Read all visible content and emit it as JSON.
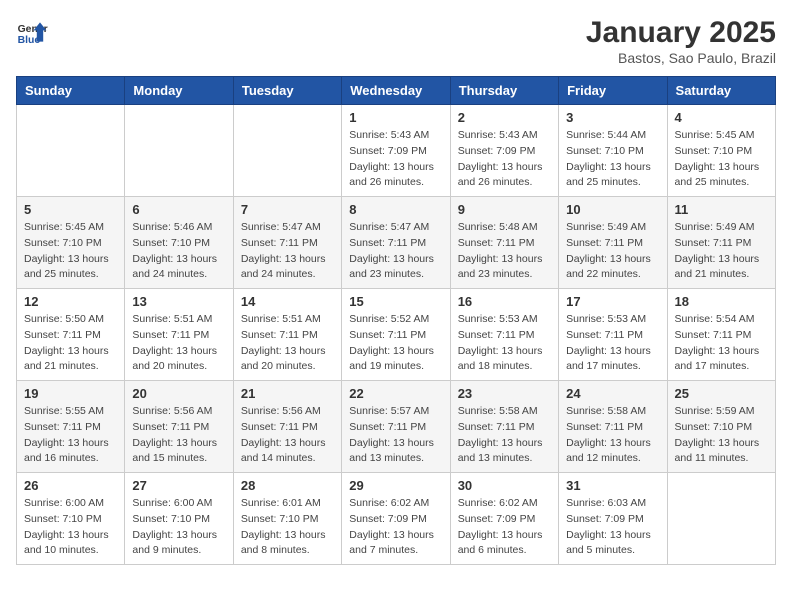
{
  "header": {
    "logo_general": "General",
    "logo_blue": "Blue",
    "month_title": "January 2025",
    "location": "Bastos, Sao Paulo, Brazil"
  },
  "weekdays": [
    "Sunday",
    "Monday",
    "Tuesday",
    "Wednesday",
    "Thursday",
    "Friday",
    "Saturday"
  ],
  "weeks": [
    [
      {
        "day": "",
        "info": ""
      },
      {
        "day": "",
        "info": ""
      },
      {
        "day": "",
        "info": ""
      },
      {
        "day": "1",
        "info": "Sunrise: 5:43 AM\nSunset: 7:09 PM\nDaylight: 13 hours and 26 minutes."
      },
      {
        "day": "2",
        "info": "Sunrise: 5:43 AM\nSunset: 7:09 PM\nDaylight: 13 hours and 26 minutes."
      },
      {
        "day": "3",
        "info": "Sunrise: 5:44 AM\nSunset: 7:10 PM\nDaylight: 13 hours and 25 minutes."
      },
      {
        "day": "4",
        "info": "Sunrise: 5:45 AM\nSunset: 7:10 PM\nDaylight: 13 hours and 25 minutes."
      }
    ],
    [
      {
        "day": "5",
        "info": "Sunrise: 5:45 AM\nSunset: 7:10 PM\nDaylight: 13 hours and 25 minutes."
      },
      {
        "day": "6",
        "info": "Sunrise: 5:46 AM\nSunset: 7:10 PM\nDaylight: 13 hours and 24 minutes."
      },
      {
        "day": "7",
        "info": "Sunrise: 5:47 AM\nSunset: 7:11 PM\nDaylight: 13 hours and 24 minutes."
      },
      {
        "day": "8",
        "info": "Sunrise: 5:47 AM\nSunset: 7:11 PM\nDaylight: 13 hours and 23 minutes."
      },
      {
        "day": "9",
        "info": "Sunrise: 5:48 AM\nSunset: 7:11 PM\nDaylight: 13 hours and 23 minutes."
      },
      {
        "day": "10",
        "info": "Sunrise: 5:49 AM\nSunset: 7:11 PM\nDaylight: 13 hours and 22 minutes."
      },
      {
        "day": "11",
        "info": "Sunrise: 5:49 AM\nSunset: 7:11 PM\nDaylight: 13 hours and 21 minutes."
      }
    ],
    [
      {
        "day": "12",
        "info": "Sunrise: 5:50 AM\nSunset: 7:11 PM\nDaylight: 13 hours and 21 minutes."
      },
      {
        "day": "13",
        "info": "Sunrise: 5:51 AM\nSunset: 7:11 PM\nDaylight: 13 hours and 20 minutes."
      },
      {
        "day": "14",
        "info": "Sunrise: 5:51 AM\nSunset: 7:11 PM\nDaylight: 13 hours and 20 minutes."
      },
      {
        "day": "15",
        "info": "Sunrise: 5:52 AM\nSunset: 7:11 PM\nDaylight: 13 hours and 19 minutes."
      },
      {
        "day": "16",
        "info": "Sunrise: 5:53 AM\nSunset: 7:11 PM\nDaylight: 13 hours and 18 minutes."
      },
      {
        "day": "17",
        "info": "Sunrise: 5:53 AM\nSunset: 7:11 PM\nDaylight: 13 hours and 17 minutes."
      },
      {
        "day": "18",
        "info": "Sunrise: 5:54 AM\nSunset: 7:11 PM\nDaylight: 13 hours and 17 minutes."
      }
    ],
    [
      {
        "day": "19",
        "info": "Sunrise: 5:55 AM\nSunset: 7:11 PM\nDaylight: 13 hours and 16 minutes."
      },
      {
        "day": "20",
        "info": "Sunrise: 5:56 AM\nSunset: 7:11 PM\nDaylight: 13 hours and 15 minutes."
      },
      {
        "day": "21",
        "info": "Sunrise: 5:56 AM\nSunset: 7:11 PM\nDaylight: 13 hours and 14 minutes."
      },
      {
        "day": "22",
        "info": "Sunrise: 5:57 AM\nSunset: 7:11 PM\nDaylight: 13 hours and 13 minutes."
      },
      {
        "day": "23",
        "info": "Sunrise: 5:58 AM\nSunset: 7:11 PM\nDaylight: 13 hours and 13 minutes."
      },
      {
        "day": "24",
        "info": "Sunrise: 5:58 AM\nSunset: 7:11 PM\nDaylight: 13 hours and 12 minutes."
      },
      {
        "day": "25",
        "info": "Sunrise: 5:59 AM\nSunset: 7:10 PM\nDaylight: 13 hours and 11 minutes."
      }
    ],
    [
      {
        "day": "26",
        "info": "Sunrise: 6:00 AM\nSunset: 7:10 PM\nDaylight: 13 hours and 10 minutes."
      },
      {
        "day": "27",
        "info": "Sunrise: 6:00 AM\nSunset: 7:10 PM\nDaylight: 13 hours and 9 minutes."
      },
      {
        "day": "28",
        "info": "Sunrise: 6:01 AM\nSunset: 7:10 PM\nDaylight: 13 hours and 8 minutes."
      },
      {
        "day": "29",
        "info": "Sunrise: 6:02 AM\nSunset: 7:09 PM\nDaylight: 13 hours and 7 minutes."
      },
      {
        "day": "30",
        "info": "Sunrise: 6:02 AM\nSunset: 7:09 PM\nDaylight: 13 hours and 6 minutes."
      },
      {
        "day": "31",
        "info": "Sunrise: 6:03 AM\nSunset: 7:09 PM\nDaylight: 13 hours and 5 minutes."
      },
      {
        "day": "",
        "info": ""
      }
    ]
  ]
}
